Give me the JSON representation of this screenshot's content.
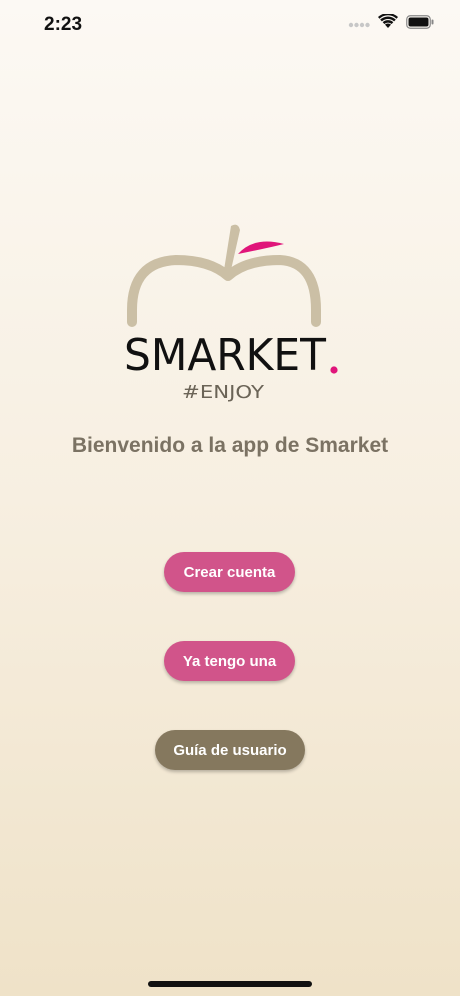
{
  "status_bar": {
    "time": "2:23",
    "icons": [
      "signal-dots-icon",
      "wifi-icon",
      "battery-icon"
    ]
  },
  "logo": {
    "brand": "SMARKET",
    "tagline": "#ENJOY"
  },
  "welcome_text": "Bienvenido a la app de Smarket",
  "buttons": {
    "create_account": "Crear cuenta",
    "have_account": "Ya tengo una",
    "user_guide": "Guía de usuario"
  },
  "colors": {
    "pink_button": "#d1548a",
    "brown_button": "#85785e",
    "welcome_text": "#7b7263",
    "logo_apple": "#cbbfa5",
    "logo_accent": "#e0157a"
  }
}
